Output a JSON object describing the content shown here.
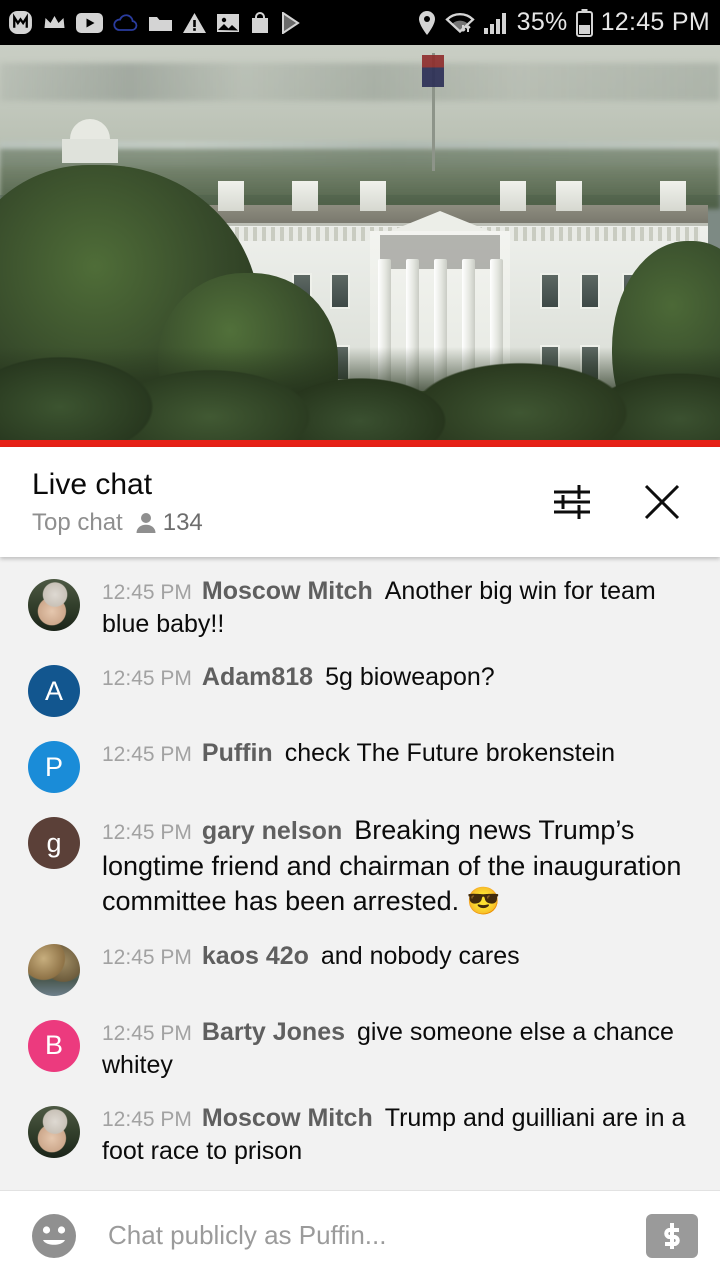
{
  "status_bar": {
    "left_icons": [
      {
        "name": "messenger-m-icon"
      },
      {
        "name": "crown-icon"
      },
      {
        "name": "youtube-icon"
      },
      {
        "name": "cloud-icon"
      },
      {
        "name": "folder-icon"
      },
      {
        "name": "warning-triangle-icon"
      },
      {
        "name": "photo-icon"
      },
      {
        "name": "shopping-bag-icon"
      },
      {
        "name": "play-store-icon"
      }
    ],
    "location_icon": "location-pin-icon",
    "wifi_icon": "wifi-icon",
    "signal_icon": "cell-signal-icon",
    "battery_percent": "35%",
    "battery_icon": "battery-icon",
    "clock": "12:45 PM"
  },
  "video": {
    "name": "white-house-live-stream",
    "progress_color": "#e62117"
  },
  "chat_header": {
    "title": "Live chat",
    "mode": "Top chat",
    "viewer_icon": "person-icon",
    "viewer_count": "134",
    "settings_icon": "tune-icon",
    "close_icon": "close-icon"
  },
  "messages": [
    {
      "avatar_type": "photo",
      "avatar_class": "photo-mitch",
      "avatar_letter": "",
      "avatar_color": "#3b4a32",
      "time": "12:45 PM",
      "author": "Moscow Mitch",
      "text": "Another big win for team blue baby!!"
    },
    {
      "avatar_type": "letter",
      "avatar_class": "",
      "avatar_letter": "A",
      "avatar_color": "#12568f",
      "time": "12:45 PM",
      "author": "Adam818",
      "text": "5g bioweapon?"
    },
    {
      "avatar_type": "letter",
      "avatar_class": "",
      "avatar_letter": "P",
      "avatar_color": "#1a8cd8",
      "time": "12:45 PM",
      "author": "Puffin",
      "text": "check The Future brokenstein"
    },
    {
      "avatar_type": "letter",
      "avatar_class": "",
      "avatar_letter": "g",
      "avatar_color": "#5b4038",
      "time": "12:45 PM",
      "author": "gary nelson",
      "text": "Breaking news Trump’s longtime friend and chairman of the inauguration committee has been arrested. 😎"
    },
    {
      "avatar_type": "photo",
      "avatar_class": "photo-kaos",
      "avatar_letter": "",
      "avatar_color": "#7d7256",
      "time": "12:45 PM",
      "author": "kaos 42o",
      "text": "and nobody cares"
    },
    {
      "avatar_type": "letter",
      "avatar_class": "",
      "avatar_letter": "B",
      "avatar_color": "#ec3a7e",
      "time": "12:45 PM",
      "author": "Barty Jones",
      "text": "give someone else a chance whitey"
    },
    {
      "avatar_type": "photo",
      "avatar_class": "photo-mitch",
      "avatar_letter": "",
      "avatar_color": "#3b4a32",
      "time": "12:45 PM",
      "author": "Moscow Mitch",
      "text": "Trump and guilliani are in a foot race to prison"
    }
  ],
  "input_bar": {
    "emoji_icon": "emoji-face-icon",
    "placeholder": "Chat publicly as Puffin...",
    "superchat_icon": "dollar-icon"
  }
}
